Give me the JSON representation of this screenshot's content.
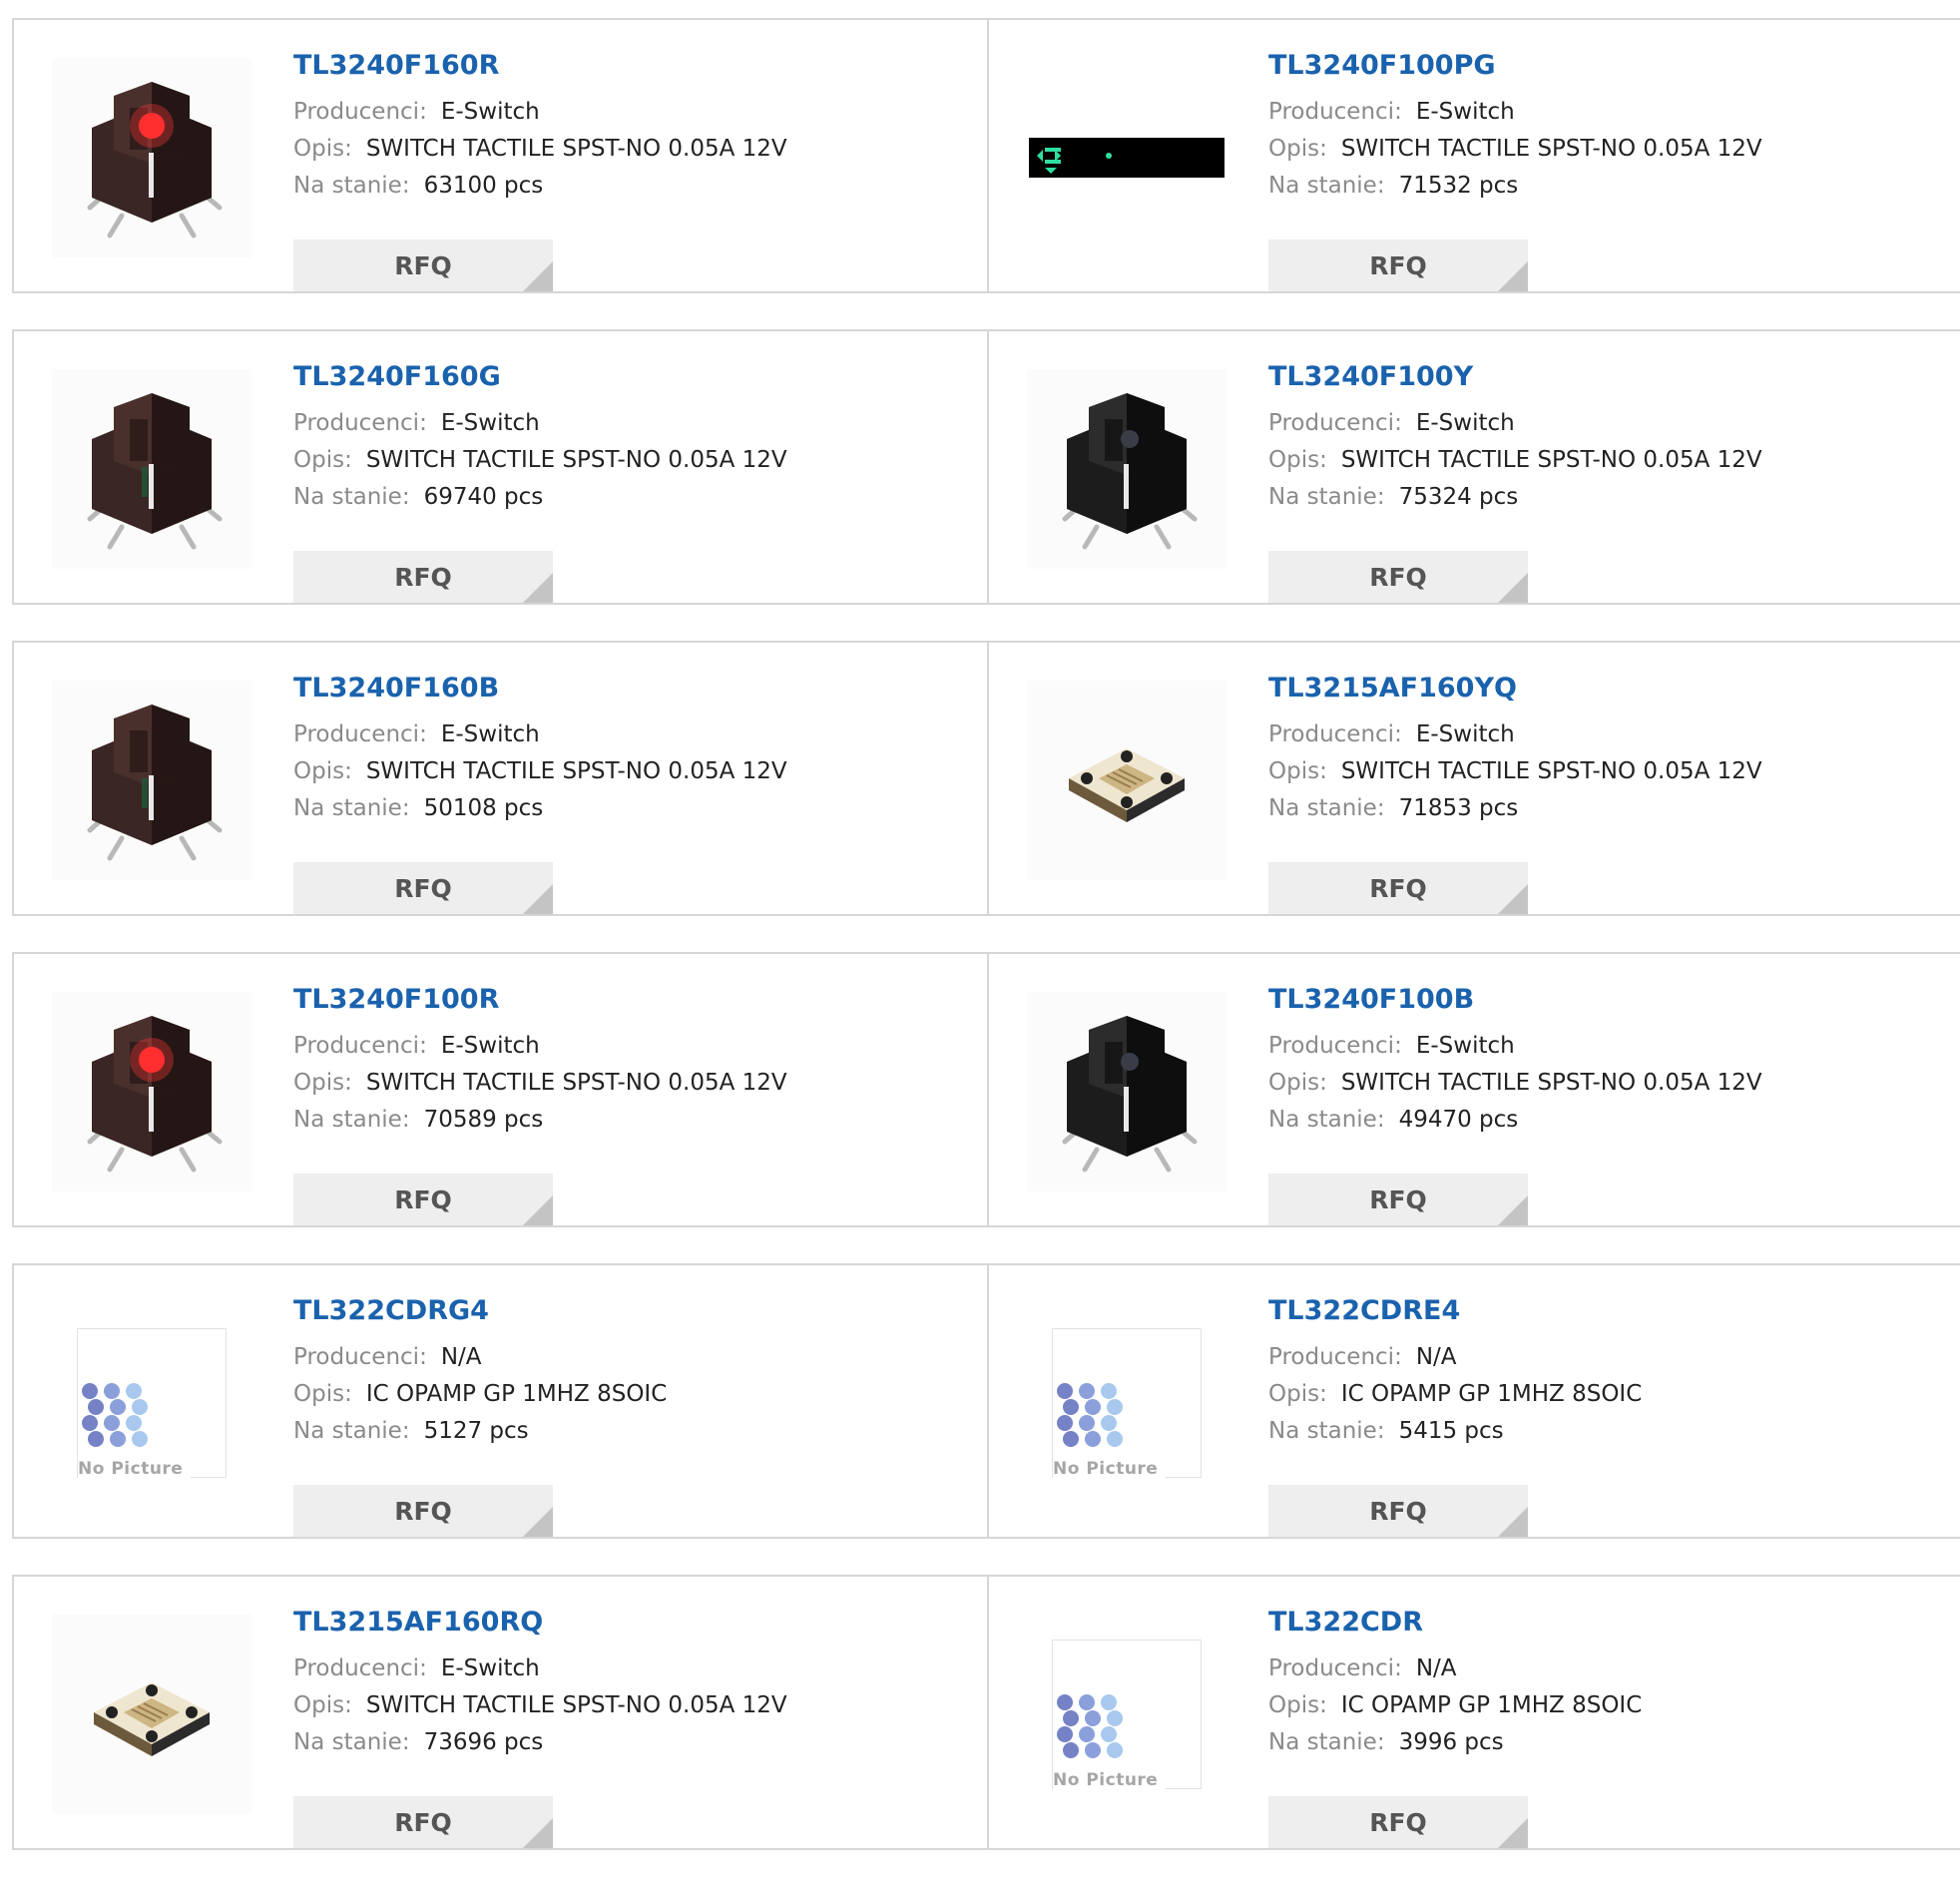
{
  "labels": {
    "manufacturer": "Producenci:",
    "description": "Opis:",
    "stock": "Na stanie:",
    "rfq": "RFQ",
    "no_picture": "No Picture"
  },
  "products": [
    {
      "part": "TL3240F160R",
      "manufacturer": "E-Switch",
      "description": "SWITCH TACTILE SPST-NO 0.05A 12V",
      "stock": "63100 pcs",
      "image": "switch-red"
    },
    {
      "part": "TL3240F100PG",
      "manufacturer": "E-Switch",
      "description": "SWITCH TACTILE SPST-NO 0.05A 12V",
      "stock": "71532 pcs",
      "image": "banner-dark"
    },
    {
      "part": "TL3240F160G",
      "manufacturer": "E-Switch",
      "description": "SWITCH TACTILE SPST-NO 0.05A 12V",
      "stock": "69740 pcs",
      "image": "switch-brown"
    },
    {
      "part": "TL3240F100Y",
      "manufacturer": "E-Switch",
      "description": "SWITCH TACTILE SPST-NO 0.05A 12V",
      "stock": "75324 pcs",
      "image": "switch-black"
    },
    {
      "part": "TL3240F160B",
      "manufacturer": "E-Switch",
      "description": "SWITCH TACTILE SPST-NO 0.05A 12V",
      "stock": "50108 pcs",
      "image": "switch-brown"
    },
    {
      "part": "TL3215AF160YQ",
      "manufacturer": "E-Switch",
      "description": "SWITCH TACTILE SPST-NO 0.05A 12V",
      "stock": "71853 pcs",
      "image": "switch-flat"
    },
    {
      "part": "TL3240F100R",
      "manufacturer": "E-Switch",
      "description": "SWITCH TACTILE SPST-NO 0.05A 12V",
      "stock": "70589 pcs",
      "image": "switch-red"
    },
    {
      "part": "TL3240F100B",
      "manufacturer": "E-Switch",
      "description": "SWITCH TACTILE SPST-NO 0.05A 12V",
      "stock": "49470 pcs",
      "image": "switch-black"
    },
    {
      "part": "TL322CDRG4",
      "manufacturer": "N/A",
      "description": "IC OPAMP GP 1MHZ 8SOIC",
      "stock": "5127 pcs",
      "image": "no-picture"
    },
    {
      "part": "TL322CDRE4",
      "manufacturer": "N/A",
      "description": "IC OPAMP GP 1MHZ 8SOIC",
      "stock": "5415 pcs",
      "image": "no-picture"
    },
    {
      "part": "TL3215AF160RQ",
      "manufacturer": "E-Switch",
      "description": "SWITCH TACTILE SPST-NO 0.05A 12V",
      "stock": "73696 pcs",
      "image": "switch-flat"
    },
    {
      "part": "TL322CDR",
      "manufacturer": "N/A",
      "description": "IC OPAMP GP 1MHZ 8SOIC",
      "stock": "3996 pcs",
      "image": "no-picture"
    }
  ],
  "colors": {
    "part_link": "#1a62ad",
    "label_gray": "#8a8a8a",
    "button_bg": "#eeeeee",
    "border": "#d6d6d6"
  }
}
